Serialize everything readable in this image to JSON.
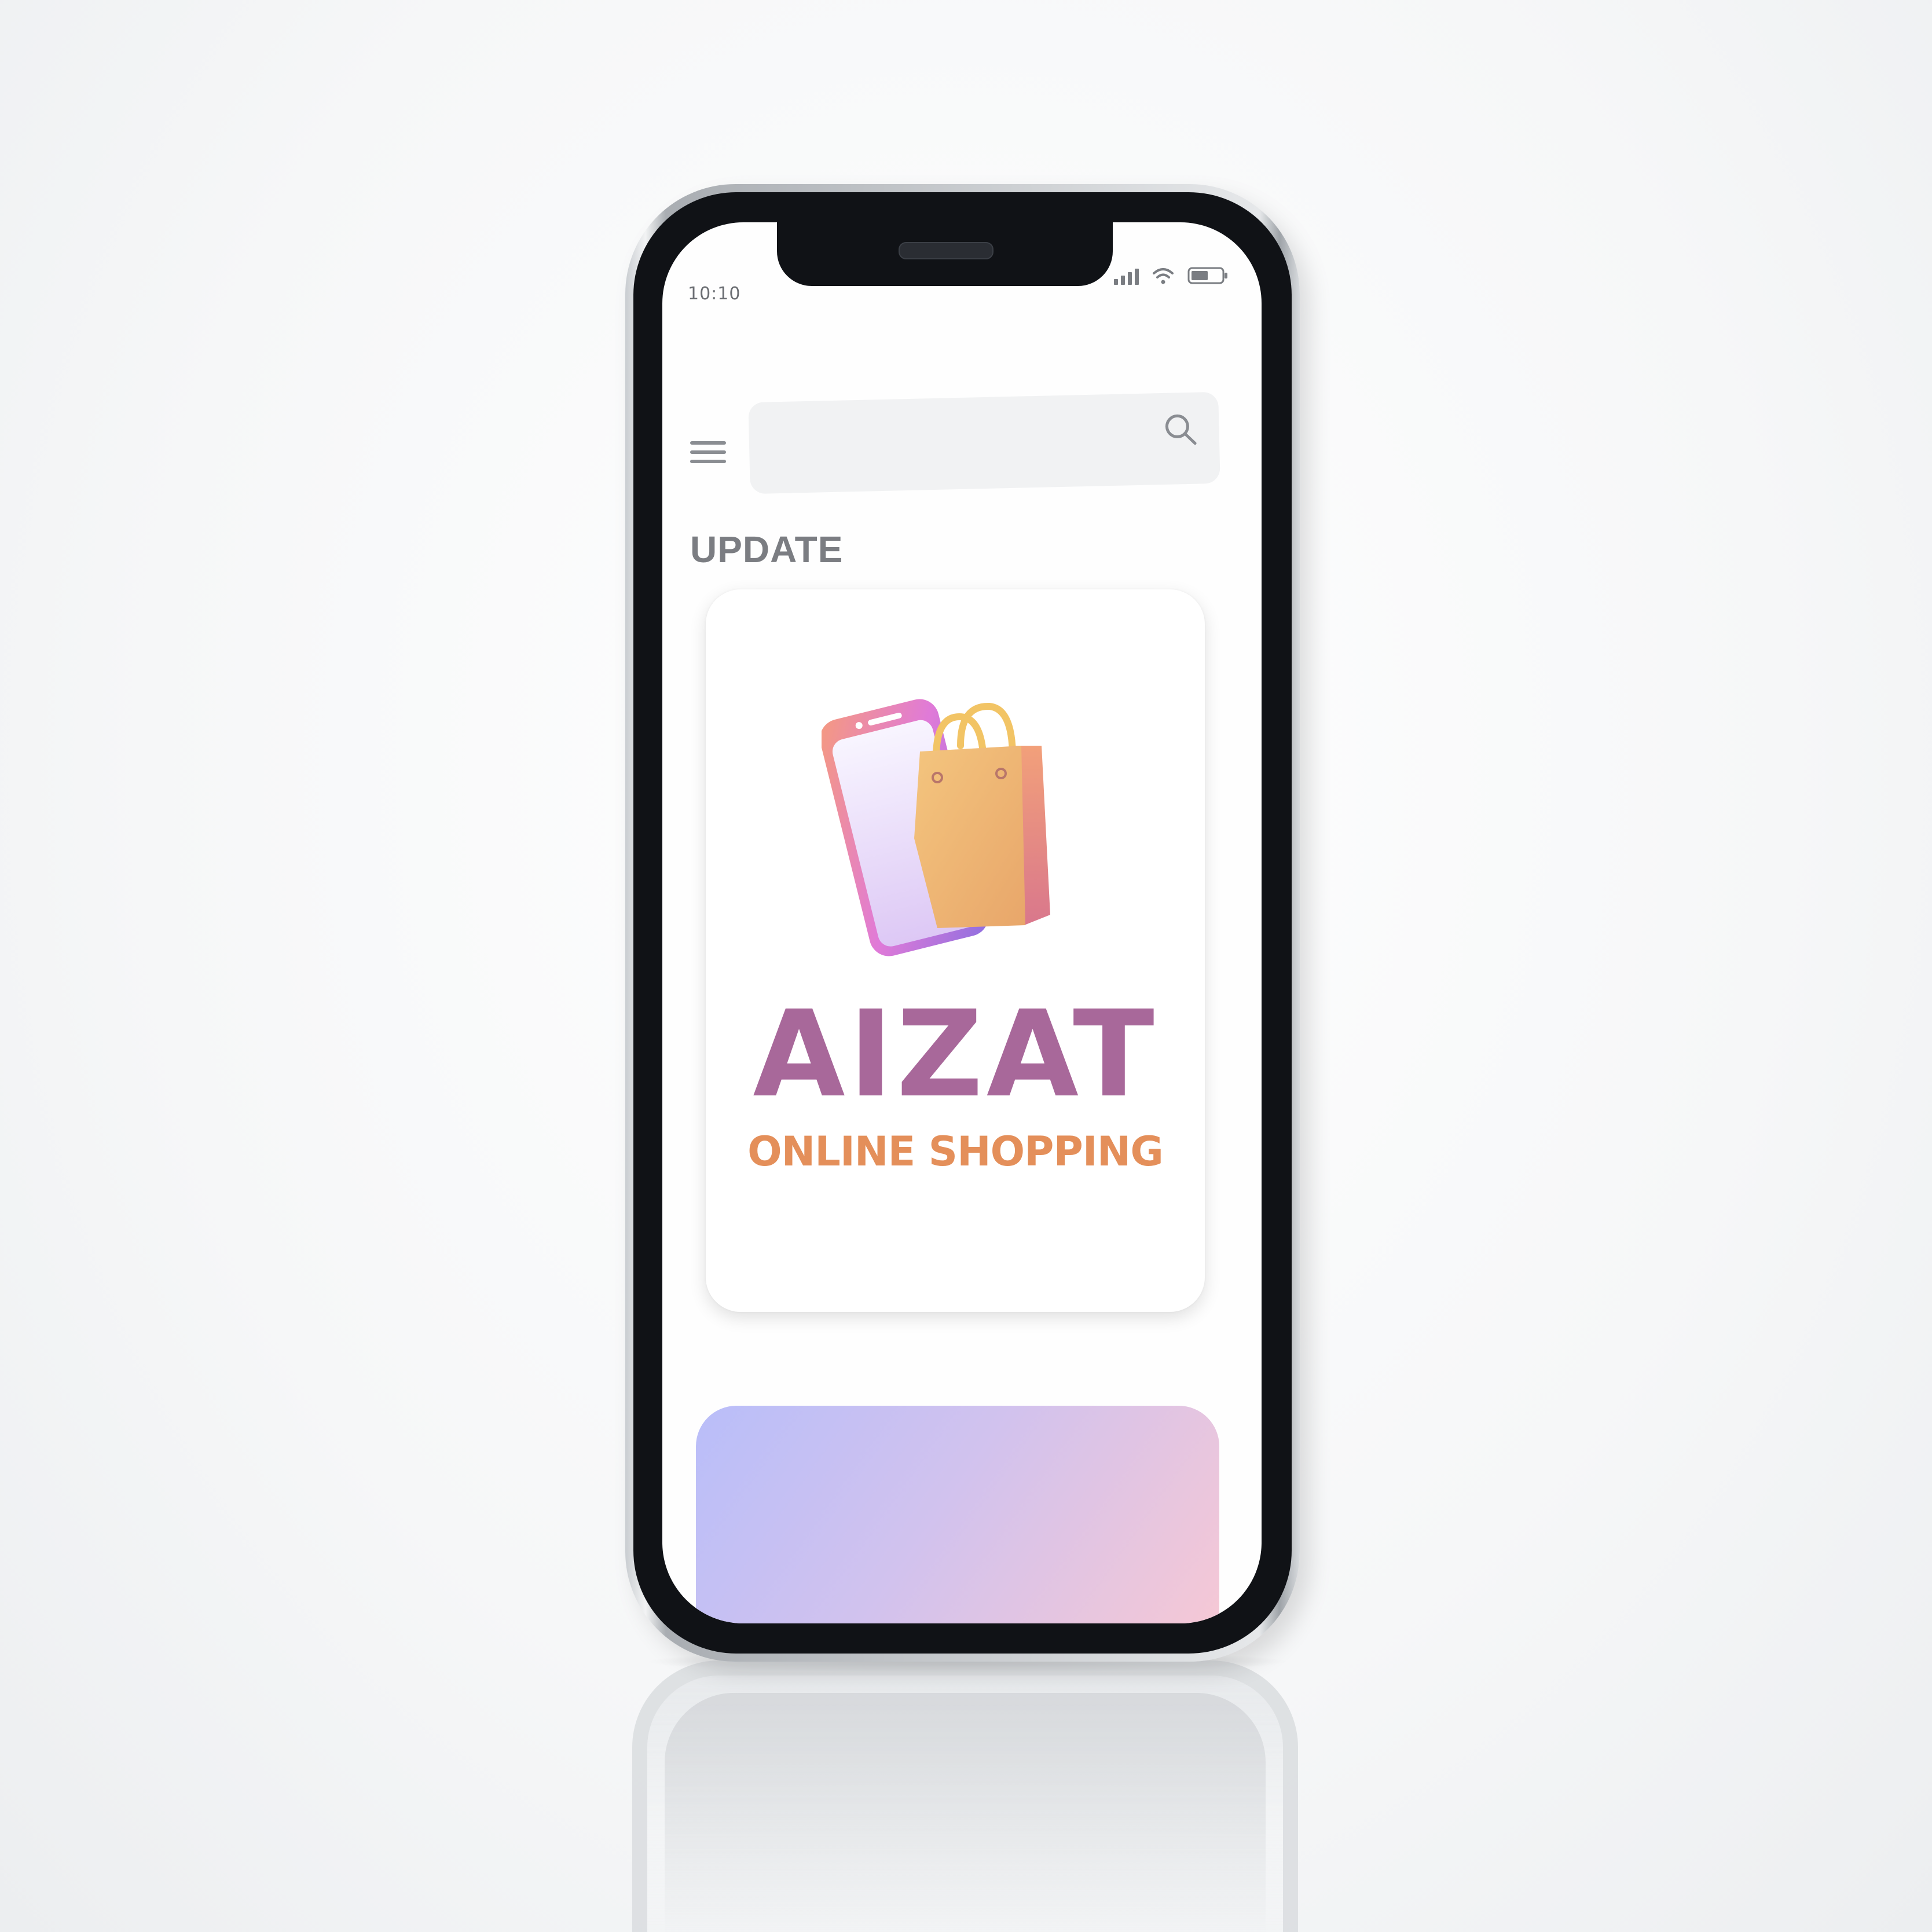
{
  "status_bar": {
    "time": "10:10",
    "icons": [
      "signal-icon",
      "wifi-icon",
      "battery-icon"
    ]
  },
  "header": {
    "menu_icon": "hamburger-menu-icon",
    "search": {
      "placeholder": "",
      "icon": "search-icon"
    }
  },
  "section": {
    "title": "UPDATE"
  },
  "promo_card": {
    "logo_icon": "phone-shopping-bag-icon",
    "brand_name": "AIZAT",
    "tagline": "ONLINE SHOPPING"
  },
  "colors": {
    "brand_purple": "#a8689a",
    "brand_orange": "#e48f5a",
    "heading_gray": "#7b7d82",
    "search_bg": "#f1f2f3",
    "card_gradient_start": "#b9bef9",
    "card_gradient_end": "#f7c8d4"
  }
}
